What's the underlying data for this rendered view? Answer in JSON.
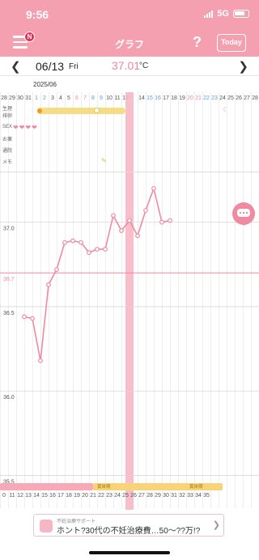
{
  "status_bar": {
    "time": "9:56",
    "network": "5G"
  },
  "header": {
    "title": "グラフ",
    "badge": "N",
    "help": "?",
    "today_label": "Today"
  },
  "date_bar": {
    "date": "06/13",
    "weekday": "Fri",
    "temperature": "37.01",
    "unit": "°C"
  },
  "calendar": {
    "month_label": "2025/06",
    "top_days": [
      "28",
      "29",
      "30",
      "31",
      "1",
      "2",
      "3",
      "4",
      "5",
      "6",
      "7",
      "8",
      "9",
      "10",
      "11",
      "12",
      "13",
      "14",
      "15",
      "16",
      "17",
      "18",
      "19",
      "20",
      "21",
      "22",
      "23",
      "24",
      "25",
      "26",
      "27",
      "28"
    ],
    "bottom_days": [
      "0",
      "11",
      "12",
      "13",
      "14",
      "15",
      "16",
      "17",
      "18",
      "19",
      "20",
      "21",
      "22",
      "23",
      "24",
      "25",
      "26",
      "27",
      "28",
      "29",
      "30",
      "31",
      "32",
      "33",
      "34",
      "35"
    ],
    "row_labels": [
      "生理",
      "排卵",
      "SEX",
      "お薬",
      "通院",
      "メモ"
    ],
    "phase_labels": [
      "黄体期",
      "黄体期"
    ]
  },
  "chart_data": {
    "type": "line",
    "y_ticks": [
      "37.0",
      "36.7",
      "36.5",
      "36.0",
      "35.5"
    ],
    "ylim": [
      35.45,
      37.3
    ],
    "cover_line": 36.7,
    "series": [
      {
        "days": [
          3,
          4,
          5,
          6,
          7,
          8,
          9,
          10,
          11,
          12,
          13,
          14,
          15,
          16,
          17,
          18,
          19,
          20,
          21,
          22,
          23
        ],
        "values": [
          36.44,
          36.43,
          36.18,
          36.63,
          36.72,
          36.88,
          36.89,
          36.88,
          36.82,
          36.84,
          36.84,
          37.04,
          36.95,
          37.01,
          36.92,
          37.07,
          37.2,
          37.0,
          37.01
        ]
      }
    ],
    "colors": {
      "line": "#f08aa0",
      "cover": "#f08aa0"
    }
  },
  "ad": {
    "sub": "不妊治療サポート",
    "main": "ホント?30代の不妊治療費…50〜??万!?"
  }
}
